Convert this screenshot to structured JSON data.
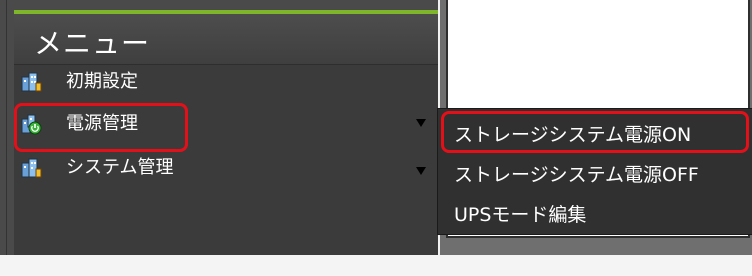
{
  "sidebar": {
    "title": "メニュー",
    "items": [
      {
        "label": "初期設定",
        "icon": "building-settings-icon",
        "has_submenu": false
      },
      {
        "label": "電源管理",
        "icon": "building-power-icon",
        "has_submenu": true
      },
      {
        "label": "システム管理",
        "icon": "building-system-icon",
        "has_submenu": true
      }
    ]
  },
  "submenu": {
    "items": [
      {
        "label": "ストレージシステム電源ON"
      },
      {
        "label": "ストレージシステム電源OFF"
      },
      {
        "label": "UPSモード編集"
      }
    ]
  },
  "colors": {
    "accent_green": "#7fb52a",
    "highlight_red": "#e3101a",
    "panel_dark": "#3b3b3b"
  }
}
